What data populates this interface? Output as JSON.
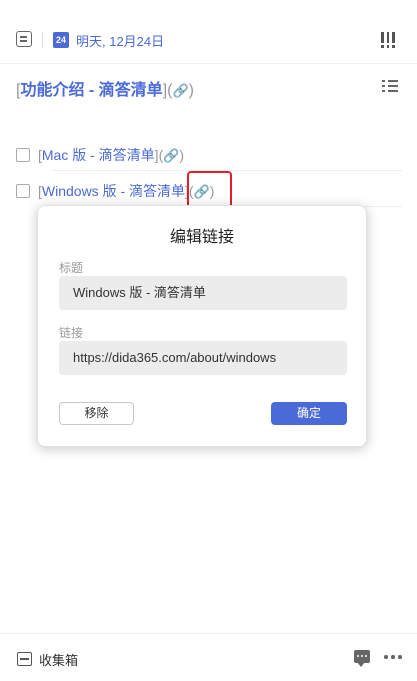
{
  "header": {
    "calendar_day": "24",
    "date_text": "明天, 12月24日"
  },
  "task": {
    "open_bracket": "[",
    "title": "功能介绍 - 滴答清单",
    "close_bracket": "]",
    "paren_open": "(",
    "link_icon": "🔗",
    "paren_close": ")"
  },
  "items": [
    {
      "open_bracket": "[",
      "text": "Mac 版 - 滴答清单",
      "close_bracket": "]",
      "paren_open": "(",
      "link_icon": "🔗",
      "paren_close": ")"
    },
    {
      "open_bracket": "[",
      "text": "Windows 版 - 滴答清单",
      "close_bracket": "]",
      "paren_open": "(",
      "link_icon": "🔗",
      "paren_close": ")"
    }
  ],
  "dialog": {
    "title": "编辑链接",
    "title_field_label": "标题",
    "title_field_value": "Windows 版 - 滴答清单",
    "link_field_label": "链接",
    "link_field_value": "https://dida365.com/about/windows",
    "remove_label": "移除",
    "confirm_label": "确定"
  },
  "footer": {
    "inbox_label": "收集箱"
  },
  "colors": {
    "accent": "#4a6ad8",
    "highlight": "#e0202a"
  },
  "icons": [
    "checkbox-icon",
    "calendar-icon",
    "priority-icon",
    "list-icon",
    "link-icon",
    "inbox-icon",
    "comment-icon",
    "more-icon"
  ]
}
